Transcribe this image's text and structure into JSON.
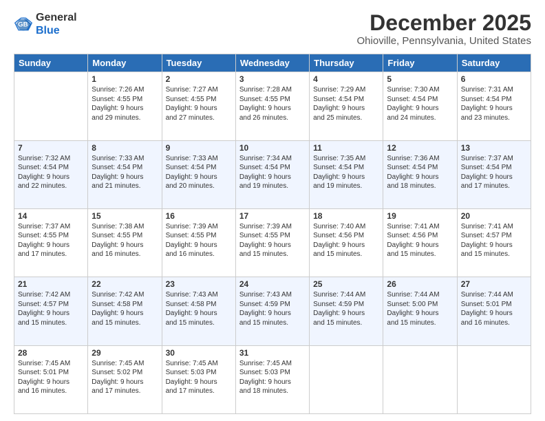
{
  "header": {
    "logo_general": "General",
    "logo_blue": "Blue",
    "month_title": "December 2025",
    "subtitle": "Ohioville, Pennsylvania, United States"
  },
  "days_of_week": [
    "Sunday",
    "Monday",
    "Tuesday",
    "Wednesday",
    "Thursday",
    "Friday",
    "Saturday"
  ],
  "weeks": [
    [
      {
        "day": "",
        "text": ""
      },
      {
        "day": "1",
        "text": "Sunrise: 7:26 AM\nSunset: 4:55 PM\nDaylight: 9 hours\nand 29 minutes."
      },
      {
        "day": "2",
        "text": "Sunrise: 7:27 AM\nSunset: 4:55 PM\nDaylight: 9 hours\nand 27 minutes."
      },
      {
        "day": "3",
        "text": "Sunrise: 7:28 AM\nSunset: 4:55 PM\nDaylight: 9 hours\nand 26 minutes."
      },
      {
        "day": "4",
        "text": "Sunrise: 7:29 AM\nSunset: 4:54 PM\nDaylight: 9 hours\nand 25 minutes."
      },
      {
        "day": "5",
        "text": "Sunrise: 7:30 AM\nSunset: 4:54 PM\nDaylight: 9 hours\nand 24 minutes."
      },
      {
        "day": "6",
        "text": "Sunrise: 7:31 AM\nSunset: 4:54 PM\nDaylight: 9 hours\nand 23 minutes."
      }
    ],
    [
      {
        "day": "7",
        "text": "Sunrise: 7:32 AM\nSunset: 4:54 PM\nDaylight: 9 hours\nand 22 minutes."
      },
      {
        "day": "8",
        "text": "Sunrise: 7:33 AM\nSunset: 4:54 PM\nDaylight: 9 hours\nand 21 minutes."
      },
      {
        "day": "9",
        "text": "Sunrise: 7:33 AM\nSunset: 4:54 PM\nDaylight: 9 hours\nand 20 minutes."
      },
      {
        "day": "10",
        "text": "Sunrise: 7:34 AM\nSunset: 4:54 PM\nDaylight: 9 hours\nand 19 minutes."
      },
      {
        "day": "11",
        "text": "Sunrise: 7:35 AM\nSunset: 4:54 PM\nDaylight: 9 hours\nand 19 minutes."
      },
      {
        "day": "12",
        "text": "Sunrise: 7:36 AM\nSunset: 4:54 PM\nDaylight: 9 hours\nand 18 minutes."
      },
      {
        "day": "13",
        "text": "Sunrise: 7:37 AM\nSunset: 4:54 PM\nDaylight: 9 hours\nand 17 minutes."
      }
    ],
    [
      {
        "day": "14",
        "text": "Sunrise: 7:37 AM\nSunset: 4:55 PM\nDaylight: 9 hours\nand 17 minutes."
      },
      {
        "day": "15",
        "text": "Sunrise: 7:38 AM\nSunset: 4:55 PM\nDaylight: 9 hours\nand 16 minutes."
      },
      {
        "day": "16",
        "text": "Sunrise: 7:39 AM\nSunset: 4:55 PM\nDaylight: 9 hours\nand 16 minutes."
      },
      {
        "day": "17",
        "text": "Sunrise: 7:39 AM\nSunset: 4:55 PM\nDaylight: 9 hours\nand 15 minutes."
      },
      {
        "day": "18",
        "text": "Sunrise: 7:40 AM\nSunset: 4:56 PM\nDaylight: 9 hours\nand 15 minutes."
      },
      {
        "day": "19",
        "text": "Sunrise: 7:41 AM\nSunset: 4:56 PM\nDaylight: 9 hours\nand 15 minutes."
      },
      {
        "day": "20",
        "text": "Sunrise: 7:41 AM\nSunset: 4:57 PM\nDaylight: 9 hours\nand 15 minutes."
      }
    ],
    [
      {
        "day": "21",
        "text": "Sunrise: 7:42 AM\nSunset: 4:57 PM\nDaylight: 9 hours\nand 15 minutes."
      },
      {
        "day": "22",
        "text": "Sunrise: 7:42 AM\nSunset: 4:58 PM\nDaylight: 9 hours\nand 15 minutes."
      },
      {
        "day": "23",
        "text": "Sunrise: 7:43 AM\nSunset: 4:58 PM\nDaylight: 9 hours\nand 15 minutes."
      },
      {
        "day": "24",
        "text": "Sunrise: 7:43 AM\nSunset: 4:59 PM\nDaylight: 9 hours\nand 15 minutes."
      },
      {
        "day": "25",
        "text": "Sunrise: 7:44 AM\nSunset: 4:59 PM\nDaylight: 9 hours\nand 15 minutes."
      },
      {
        "day": "26",
        "text": "Sunrise: 7:44 AM\nSunset: 5:00 PM\nDaylight: 9 hours\nand 15 minutes."
      },
      {
        "day": "27",
        "text": "Sunrise: 7:44 AM\nSunset: 5:01 PM\nDaylight: 9 hours\nand 16 minutes."
      }
    ],
    [
      {
        "day": "28",
        "text": "Sunrise: 7:45 AM\nSunset: 5:01 PM\nDaylight: 9 hours\nand 16 minutes."
      },
      {
        "day": "29",
        "text": "Sunrise: 7:45 AM\nSunset: 5:02 PM\nDaylight: 9 hours\nand 17 minutes."
      },
      {
        "day": "30",
        "text": "Sunrise: 7:45 AM\nSunset: 5:03 PM\nDaylight: 9 hours\nand 17 minutes."
      },
      {
        "day": "31",
        "text": "Sunrise: 7:45 AM\nSunset: 5:03 PM\nDaylight: 9 hours\nand 18 minutes."
      },
      {
        "day": "",
        "text": ""
      },
      {
        "day": "",
        "text": ""
      },
      {
        "day": "",
        "text": ""
      }
    ]
  ]
}
